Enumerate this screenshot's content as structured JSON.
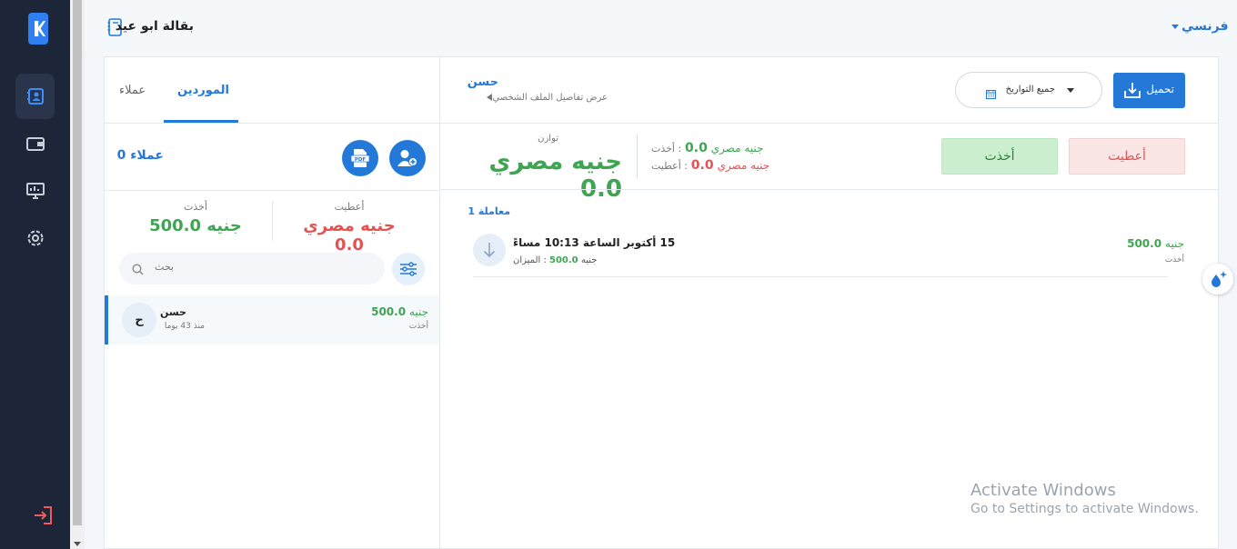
{
  "header": {
    "shop_name": "بقالة ابو عيد",
    "language": "فرنسي"
  },
  "sidebar": {
    "items": [
      "contacts-icon",
      "wallet-icon",
      "monitor-icon",
      "settings-icon"
    ],
    "logout": "exit-icon"
  },
  "left_panel": {
    "tabs": {
      "active": "الموردين",
      "inactive": "عملاء"
    },
    "customers_count": "عملاء 0",
    "buttons": {
      "pdf": "PDF"
    },
    "summary": {
      "given_label": "أعطيت",
      "given_value": "جنيه مصري 0.0",
      "taken_label": "أخذت",
      "taken_value": "جنيه 500.0"
    },
    "search_placeholder": "بحث",
    "entries": [
      {
        "avatar": "ح",
        "name": "حسن",
        "since": "منذ 43 يوما",
        "amount_unit": "جنيه",
        "amount": "500.0",
        "label": "أخذت"
      }
    ]
  },
  "right_panel": {
    "profile": {
      "name": "حسن",
      "link": "عرض تفاصيل الملف الشخصي"
    },
    "date_filter": "جميع التواريخ",
    "download_label": "تحميل",
    "give_button": "أعطيت",
    "take_button": "أخذت",
    "taken_line": {
      "unit": "جنيه مصري",
      "value": "0.0",
      "label": ": أخذت"
    },
    "given_line": {
      "unit": "جنيه مصري",
      "value": "0.0",
      "label": ": أعطيت"
    },
    "balance_label": "توازن",
    "balance_value": "جنيه مصري 0.0",
    "transactions_count": "معاملة 1",
    "transactions": [
      {
        "date": "15 أكتوبر الساعة 10:13 مساءً",
        "balance_unit": "جنيه",
        "balance_value": "500.0",
        "balance_label": ": الميزان",
        "amount_unit": "جنيه",
        "amount": "500.0",
        "label": "أخذت"
      }
    ]
  },
  "watermark": {
    "line1": "Activate Windows",
    "line2": "Go to Settings to activate Windows."
  },
  "colors": {
    "accent": "#2479d8",
    "green": "#3fa553",
    "red": "#e35353",
    "rail": "#1d2638"
  }
}
